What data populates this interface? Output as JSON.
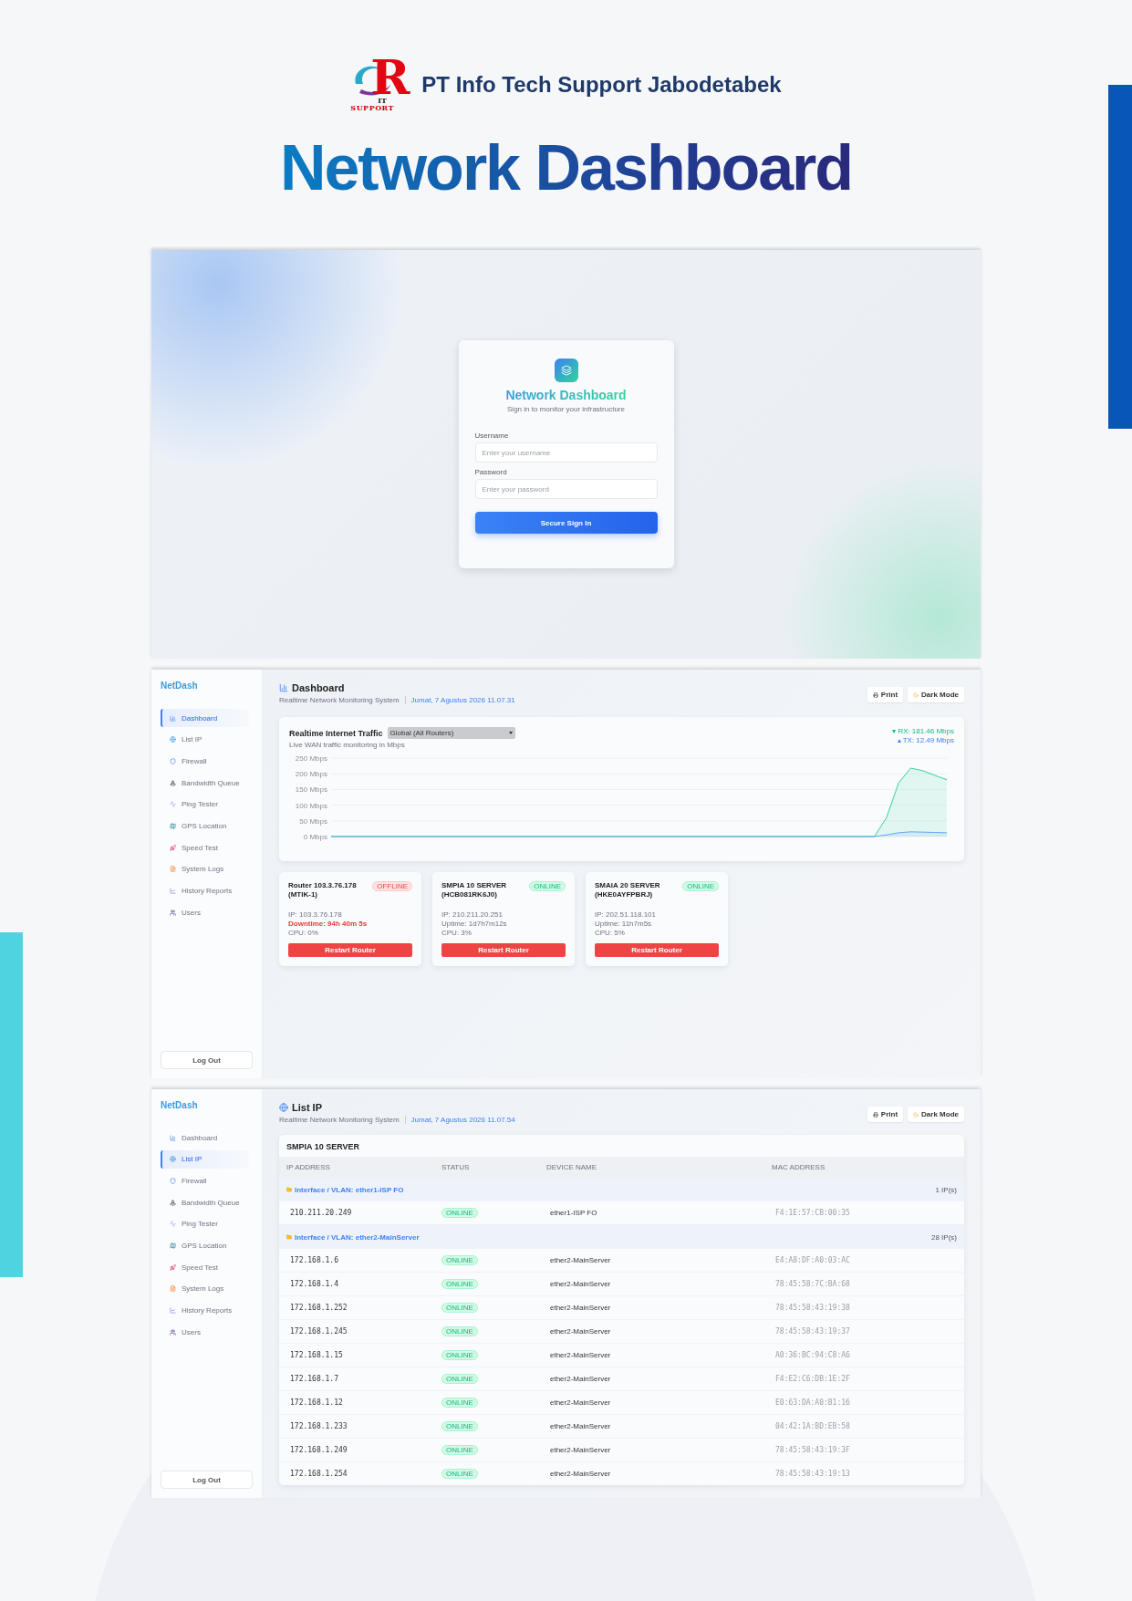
{
  "header": {
    "logo": {
      "letter": "R",
      "tag_top": "IT",
      "tag": "SUPPORT"
    },
    "company": "PT Info Tech Support Jabodetabek",
    "title": "Network Dashboard"
  },
  "login": {
    "title": "Network Dashboard",
    "subtitle": "Sign in to monitor your infrastructure",
    "fields": [
      {
        "label": "Username",
        "placeholder": "Enter your username"
      },
      {
        "label": "Password",
        "placeholder": "Enter your password"
      }
    ],
    "button": "Secure Sign In"
  },
  "dashboard": {
    "brand": "NetDash",
    "nav": [
      {
        "label": "Dashboard",
        "selected": true
      },
      {
        "label": "List IP",
        "selected": false
      },
      {
        "label": "Firewall",
        "selected": false
      },
      {
        "label": "Bandwidth Queue",
        "selected": false
      },
      {
        "label": "Ping Tester",
        "selected": false
      },
      {
        "label": "GPS Location",
        "selected": false
      },
      {
        "label": "Speed Test",
        "selected": false
      },
      {
        "label": "System Logs",
        "selected": false
      },
      {
        "label": "History Reports",
        "selected": false
      },
      {
        "label": "Users",
        "selected": false
      }
    ],
    "logout": "Log Out",
    "page_title": "Dashboard",
    "subtitle": "Realtime Network Monitoring System",
    "date": "Jumat, 7 Agustus 2026 11.07.31",
    "actions": [
      "Print",
      "Dark Mode"
    ],
    "traffic": {
      "title": "Realtime Internet Traffic",
      "select": "Global (All Routers)",
      "caption": "Live WAN traffic monitoring in Mbps",
      "legend": [
        {
          "reading": "181.46 Mbps",
          "color": "#10b981"
        },
        {
          "reading": "12.49 Mbps",
          "color": "#3b82f6"
        }
      ],
      "chart_data": {
        "type": "area",
        "grid": true,
        "ylim": [
          0,
          250
        ],
        "yticks": [
          {
            "value": 0,
            "label": "0 Mbps"
          },
          {
            "value": 50,
            "label": "50 Mbps"
          },
          {
            "value": 100,
            "label": "100 Mbps"
          },
          {
            "value": 150,
            "label": "150 Mbps"
          },
          {
            "value": 200,
            "label": "200 Mbps"
          },
          {
            "value": 250,
            "label": "250 Mbps"
          }
        ],
        "series": [
          {
            "name": "RX:",
            "color": "#34d399",
            "values": [
              0,
              0,
              0,
              0,
              0,
              0,
              0,
              0,
              0,
              0,
              0,
              0,
              0,
              0,
              0,
              0,
              0,
              0,
              0,
              0,
              0,
              0,
              0,
              0,
              0,
              0,
              0,
              0,
              0,
              0,
              0,
              0,
              0,
              0,
              0,
              0,
              0,
              0,
              0,
              0,
              0,
              0,
              0,
              0,
              0,
              0,
              60,
              170,
              218,
              210,
              195,
              181
            ]
          },
          {
            "name": "TX:",
            "color": "#60a5fa",
            "values": [
              0,
              0,
              0,
              0,
              0,
              0,
              0,
              0,
              0,
              0,
              0,
              0,
              0,
              0,
              0,
              0,
              0,
              0,
              0,
              0,
              0,
              0,
              0,
              0,
              0,
              0,
              0,
              0,
              0,
              0,
              0,
              0,
              0,
              0,
              0,
              0,
              0,
              0,
              0,
              0,
              0,
              0,
              0,
              0,
              0,
              0,
              5,
              12,
              15,
              14,
              13,
              12
            ]
          }
        ]
      }
    },
    "routers": [
      {
        "name": "Router 103.3.76.178 (MTIK-1)",
        "status": "OFFLINE",
        "online": false,
        "lines": [
          "IP: 103.3.76.178",
          "Downtime: 94h 40m 5s",
          "CPU: 0%"
        ],
        "button": "Restart Router"
      },
      {
        "name": "SMPIA 10 SERVER (HCB081RK6J0)",
        "status": "ONLINE",
        "online": true,
        "lines": [
          "IP: 210.211.20.251",
          "Uptime: 1d7h7m12s",
          "CPU: 3%"
        ],
        "button": "Restart Router"
      },
      {
        "name": "SMAIA 20 SERVER (HKE0AYFPBRJ)",
        "status": "ONLINE",
        "online": true,
        "lines": [
          "IP: 202.51.118.101",
          "Uptime: 11h7m5s",
          "CPU: 5%"
        ],
        "button": "Restart Router"
      }
    ]
  },
  "list_ip": {
    "brand": "NetDash",
    "nav": [
      {
        "label": "Dashboard",
        "selected": false
      },
      {
        "label": "List IP",
        "selected": true
      },
      {
        "label": "Firewall",
        "selected": false
      },
      {
        "label": "Bandwidth Queue",
        "selected": false
      },
      {
        "label": "Ping Tester",
        "selected": false
      },
      {
        "label": "GPS Location",
        "selected": false
      },
      {
        "label": "Speed Test",
        "selected": false
      },
      {
        "label": "System Logs",
        "selected": false
      },
      {
        "label": "History Reports",
        "selected": false
      },
      {
        "label": "Users",
        "selected": false
      }
    ],
    "logout": "Log Out",
    "page_title": "List IP",
    "subtitle": "Realtime Network Monitoring System",
    "date": "Jumat, 7 Agustus 2026 11.07.54",
    "actions": [
      "Print",
      "Dark Mode"
    ],
    "table": {
      "title": "SMPIA 10 SERVER",
      "columns": [
        "IP ADDRESS",
        "STATUS",
        "DEVICE NAME",
        "MAC ADDRESS"
      ],
      "groups": [
        {
          "label": "Interface / VLAN: ether1-ISP FO",
          "count": "1 IP(s)",
          "rows": [
            {
              "ip": "210.211.20.249",
              "status": "ONLINE",
              "device": "ether1-ISP FO",
              "mac": "F4:1E:57:CB:00:35"
            }
          ]
        },
        {
          "label": "Interface / VLAN: ether2-MainServer",
          "count": "28 IP(s)",
          "rows": [
            {
              "ip": "172.168.1.6",
              "status": "ONLINE",
              "device": "ether2-MainServer",
              "mac": "E4:A8:DF:A0:03:AC"
            },
            {
              "ip": "172.168.1.4",
              "status": "ONLINE",
              "device": "ether2-MainServer",
              "mac": "78:45:58:7C:BA:68"
            },
            {
              "ip": "172.168.1.252",
              "status": "ONLINE",
              "device": "ether2-MainServer",
              "mac": "78:45:58:43:19:38"
            },
            {
              "ip": "172.168.1.245",
              "status": "ONLINE",
              "device": "ether2-MainServer",
              "mac": "78:45:58:43:19:37"
            },
            {
              "ip": "172.168.1.15",
              "status": "ONLINE",
              "device": "ether2-MainServer",
              "mac": "A0:36:BC:94:C8:A6"
            },
            {
              "ip": "172.168.1.7",
              "status": "ONLINE",
              "device": "ether2-MainServer",
              "mac": "F4:E2:C6:DB:1E:2F"
            },
            {
              "ip": "172.168.1.12",
              "status": "ONLINE",
              "device": "ether2-MainServer",
              "mac": "E0:63:DA:A0:B1:16"
            },
            {
              "ip": "172.168.1.233",
              "status": "ONLINE",
              "device": "ether2-MainServer",
              "mac": "04:42:1A:BD:EB:58"
            },
            {
              "ip": "172.168.1.249",
              "status": "ONLINE",
              "device": "ether2-MainServer",
              "mac": "78:45:58:43:19:3F"
            },
            {
              "ip": "172.168.1.254",
              "status": "ONLINE",
              "device": "ether2-MainServer",
              "mac": "78:45:58:43:19:13"
            }
          ]
        }
      ]
    }
  }
}
